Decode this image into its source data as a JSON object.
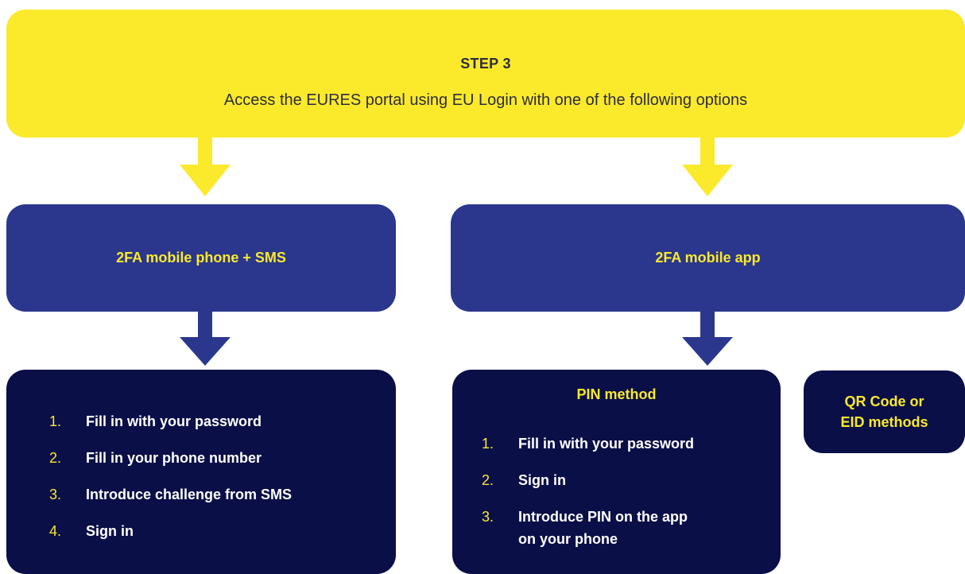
{
  "step": {
    "title": "STEP 3",
    "subtitle": "Access the EURES portal using EU Login with one of the following options"
  },
  "options": {
    "sms": {
      "label": "2FA mobile phone + SMS"
    },
    "app": {
      "label": "2FA mobile app"
    }
  },
  "sms_steps": [
    {
      "num": "1.",
      "text": "Fill in with your password"
    },
    {
      "num": "2.",
      "text": "Fill in your phone number"
    },
    {
      "num": "3.",
      "text": "Introduce challenge from SMS"
    },
    {
      "num": "4.",
      "text": "Sign in"
    }
  ],
  "pin_method": {
    "title": "PIN method",
    "steps": [
      {
        "num": "1.",
        "text": "Fill in with your password"
      },
      {
        "num": "2.",
        "text": "Sign in"
      },
      {
        "num": "3.",
        "text": "Introduce PIN on the app",
        "text2": "on your phone"
      }
    ]
  },
  "other_methods": {
    "line1": "QR Code or",
    "line2": "EID methods"
  },
  "colors": {
    "yellow": "#fbe92c",
    "blue": "#2a378d",
    "navy": "#0a0f48"
  }
}
